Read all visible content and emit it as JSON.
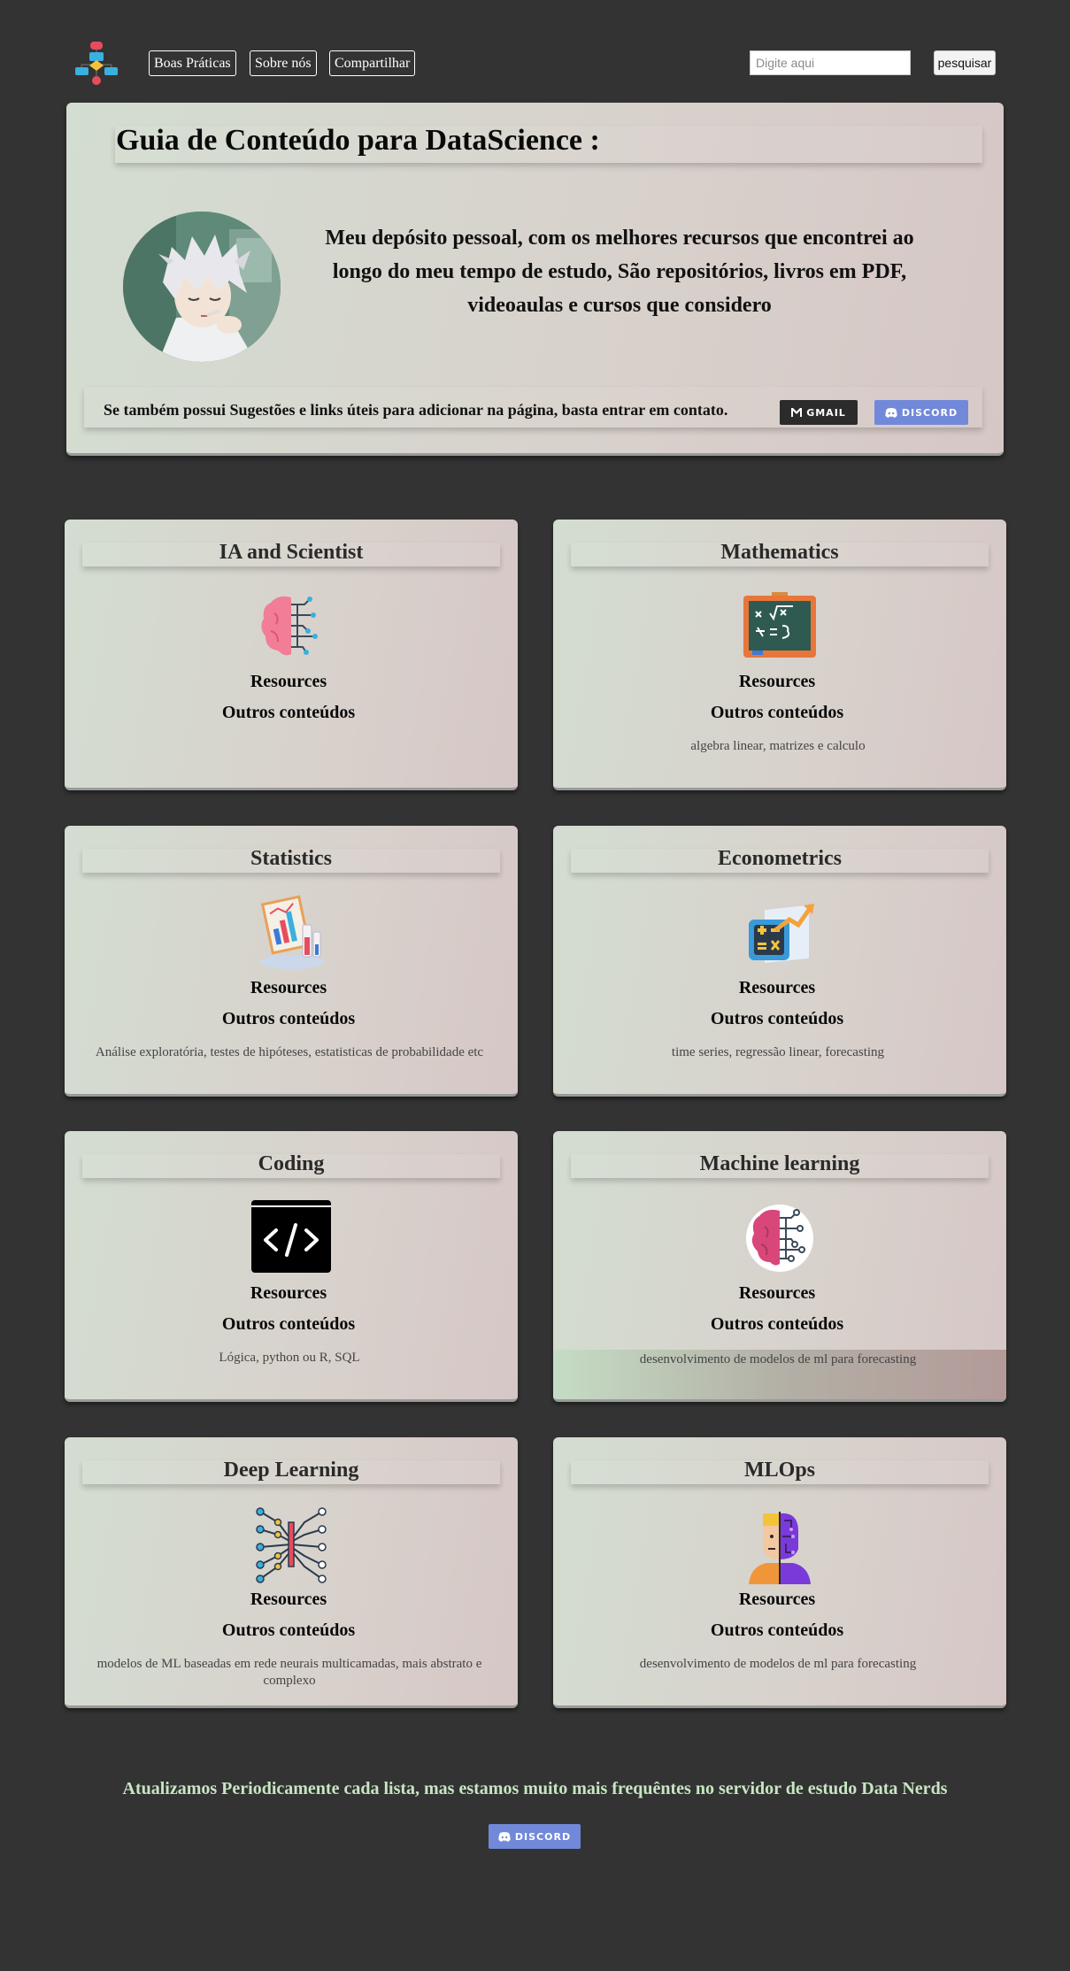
{
  "nav": {
    "links": [
      "Boas Práticas",
      "Sobre nós",
      "Compartilhar"
    ],
    "search_placeholder": "Digite aqui",
    "search_button": "pesquisar"
  },
  "hero": {
    "title": "Guia de Conteúdo para DataScience :",
    "description": "Meu depósito pessoal, com os melhores recursos que encontrei ao longo do meu tempo de estudo, São repositórios, livros em PDF, videoaulas e cursos que considero",
    "contact_text": "Se também possui Sugestões e links úteis para adicionar na página, basta entrar em contato.",
    "gmail_label": "GMAIL",
    "discord_label": "DISCORD"
  },
  "cards": [
    {
      "title": "IA and Scientist",
      "icon": "brain-circuit-icon",
      "resources": "Resources",
      "others": "Outros conteúdos",
      "description": ""
    },
    {
      "title": "Mathematics",
      "icon": "chalkboard-math-icon",
      "resources": "Resources",
      "others": "Outros conteúdos",
      "description": "algebra linear, matrizes e calculo"
    },
    {
      "title": "Statistics",
      "icon": "statistics-board-icon",
      "resources": "Resources",
      "others": "Outros conteúdos",
      "description": "Análise exploratória, testes de hipóteses, estatisticas de probabilidade etc"
    },
    {
      "title": "Econometrics",
      "icon": "calculator-trend-icon",
      "resources": "Resources",
      "others": "Outros conteúdos",
      "description": "time series, regressão linear, forecasting"
    },
    {
      "title": "Coding",
      "icon": "code-window-icon",
      "resources": "Resources",
      "others": "Outros conteúdos",
      "description": "Lógica, python ou R, SQL"
    },
    {
      "title": "Machine learning",
      "icon": "brain-sticker-icon",
      "resources": "Resources",
      "others": "Outros conteúdos",
      "description": "desenvolvimento de modelos de ml para forecasting"
    },
    {
      "title": "Deep Learning",
      "icon": "neural-network-icon",
      "resources": "Resources",
      "others": "Outros conteúdos",
      "description": "modelos de ML baseadas em rede neurais multicamadas, mais abstrato e complexo"
    },
    {
      "title": "MLOps",
      "icon": "cyborg-person-icon",
      "resources": "Resources",
      "others": "Outros conteúdos",
      "description": "desenvolvimento de modelos de ml para forecasting"
    }
  ],
  "footer": {
    "text": "Atualizamos Periodicamente cada lista, mas estamos muito mais frequêntes no servidor de estudo Data Nerds",
    "discord_label": "DISCORD"
  },
  "colors": {
    "background": "#333333",
    "card_gradient_start": "#d3ddd1",
    "card_gradient_end": "#d6c7c6",
    "footer_text": "#c7e6c2",
    "discord": "#7289da",
    "gmail": "#2b2b2b"
  }
}
